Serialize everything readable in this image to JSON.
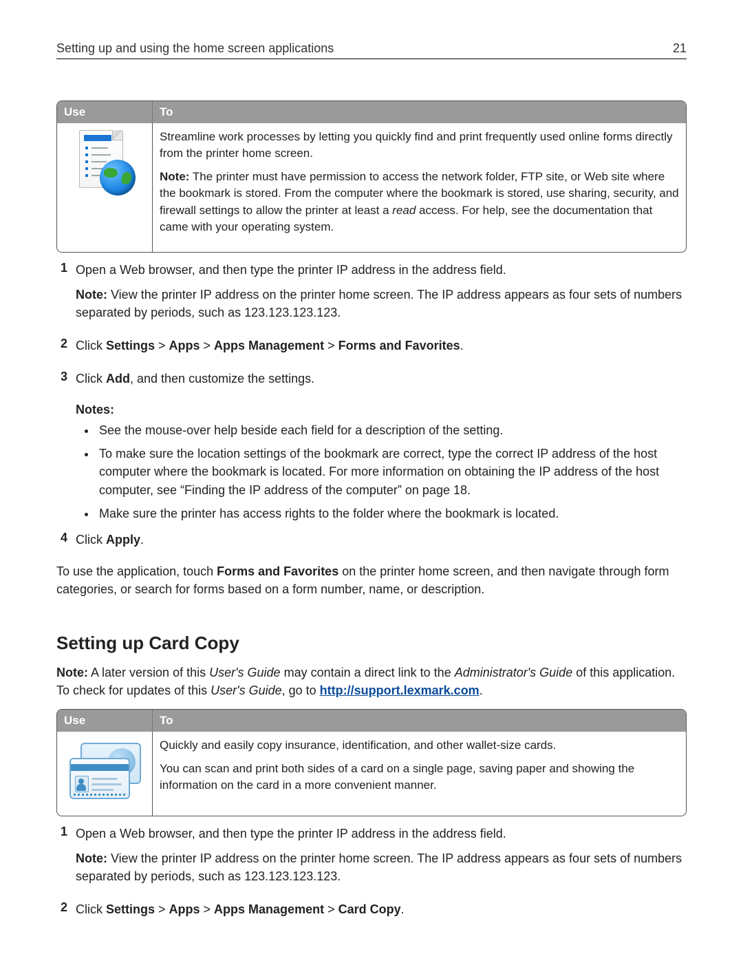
{
  "header": {
    "title": "Setting up and using the home screen applications",
    "page_number": "21"
  },
  "table1": {
    "col1": "Use",
    "col2": "To",
    "desc1": "Streamline work processes by letting you quickly find and print frequently used online forms directly from the printer home screen.",
    "note_label": "Note:",
    "note_pre": " The printer must have permission to access the network folder, FTP site, or Web site where the bookmark is stored. From the computer where the bookmark is stored, use sharing, security, and firewall settings to allow the printer at least a ",
    "note_em": "read",
    "note_post": " access. For help, see the documentation that came with your operating system."
  },
  "steps1": {
    "s1": {
      "num": "1",
      "text": "Open a Web browser, and then type the printer IP address in the address field.",
      "note_label": "Note:",
      "note_text": " View the printer IP address on the printer home screen. The IP address appears as four sets of numbers separated by periods, such as 123.123.123.123."
    },
    "s2": {
      "num": "2",
      "pre": "Click ",
      "b1": "Settings",
      "gt1": " > ",
      "b2": "Apps",
      "gt2": " > ",
      "b3": "Apps Management",
      "gt3": " > ",
      "b4": "Forms and Favorites",
      "post": "."
    },
    "s3": {
      "num": "3",
      "pre": "Click ",
      "b1": "Add",
      "post": ", and then customize the settings."
    },
    "s4": {
      "num": "4",
      "pre": "Click ",
      "b1": "Apply",
      "post": "."
    }
  },
  "notes1": {
    "title": "Notes:",
    "b1": "See the mouse-over help beside each field for a description of the setting.",
    "b2": "To make sure the location settings of the bookmark are correct, type the correct IP address of the host computer where the bookmark is located. For more information on obtaining the IP address of the host computer, see “Finding the IP address of the computer” on page 18.",
    "b3": "Make sure the printer has access rights to the folder where the bookmark is located."
  },
  "para_after_steps1": {
    "pre": "To use the application, touch ",
    "b1": "Forms and Favorites",
    "post": " on the printer home screen, and then navigate through form categories, or search for forms based on a form number, name, or description."
  },
  "section2": {
    "heading": "Setting up Card Copy",
    "note_label": "Note:",
    "note_p1": " A later version of this ",
    "em1": "User's Guide",
    "note_p2": " may contain a direct link to the ",
    "em2": "Administrator's Guide",
    "note_p3": " of this application. To check for updates of this ",
    "em3": "User's Guide",
    "note_p4": ", go to ",
    "link_text": "http://support.lexmark.com",
    "note_p5": "."
  },
  "table2": {
    "col1": "Use",
    "col2": "To",
    "desc1": "Quickly and easily copy insurance, identification, and other wallet-size cards.",
    "desc2": "You can scan and print both sides of a card on a single page, saving paper and showing the information on the card in a more convenient manner."
  },
  "steps2": {
    "s1": {
      "num": "1",
      "text": "Open a Web browser, and then type the printer IP address in the address field.",
      "note_label": "Note:",
      "note_text": " View the printer IP address on the printer home screen. The IP address appears as four sets of numbers separated by periods, such as 123.123.123.123."
    },
    "s2": {
      "num": "2",
      "pre": "Click ",
      "b1": "Settings",
      "gt1": " > ",
      "b2": "Apps",
      "gt2": " > ",
      "b3": "Apps Management",
      "gt3": " > ",
      "b4": "Card Copy",
      "post": "."
    }
  }
}
